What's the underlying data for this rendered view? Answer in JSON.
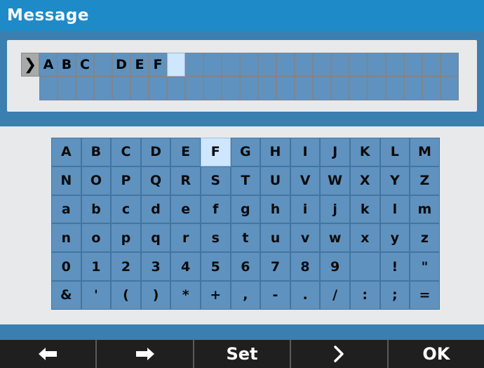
{
  "title": "Message",
  "message": {
    "cursor_glyph": "❯",
    "row1": [
      "A",
      "B",
      "C",
      "",
      "D",
      "E",
      "F",
      "",
      "",
      "",
      "",
      "",
      "",
      "",
      "",
      "",
      "",
      "",
      "",
      "",
      "",
      "",
      "",
      ""
    ],
    "row2": [
      "",
      "",
      "",
      "",
      "",
      "",
      "",
      "",
      "",
      "",
      "",
      "",
      "",
      "",
      "",
      "",
      "",
      "",
      "",
      "",
      "",
      "",
      ""
    ],
    "active_index": 7
  },
  "keyboard": {
    "selected": "F",
    "rows": [
      [
        "A",
        "B",
        "C",
        "D",
        "E",
        "F",
        "G",
        "H",
        "I",
        "J",
        "K",
        "L",
        "M"
      ],
      [
        "N",
        "O",
        "P",
        "Q",
        "R",
        "S",
        "T",
        "U",
        "V",
        "W",
        "X",
        "Y",
        "Z"
      ],
      [
        "a",
        "b",
        "c",
        "d",
        "e",
        "f",
        "g",
        "h",
        "i",
        "j",
        "k",
        "l",
        "m"
      ],
      [
        "n",
        "o",
        "p",
        "q",
        "r",
        "s",
        "t",
        "u",
        "v",
        "w",
        "x",
        "y",
        "z"
      ],
      [
        "0",
        "1",
        "2",
        "3",
        "4",
        "5",
        "6",
        "7",
        "8",
        "9",
        "",
        "!",
        "\""
      ],
      [
        "&",
        "'",
        "(",
        ")",
        "*",
        "+",
        ",",
        "-",
        ".",
        "/",
        ":",
        ";",
        "="
      ]
    ]
  },
  "softkeys": {
    "left_icon": "left-arrow-icon",
    "right_icon": "right-arrow-icon",
    "set": "Set",
    "next_icon": "chevron-right-icon",
    "ok": "OK"
  },
  "colors": {
    "title_bar": "#1f8ac8",
    "key": "#5f92bf",
    "selected_key": "#cfe6ff",
    "panel": "#e8e9eb",
    "softkey_bar": "#1f1f20"
  }
}
